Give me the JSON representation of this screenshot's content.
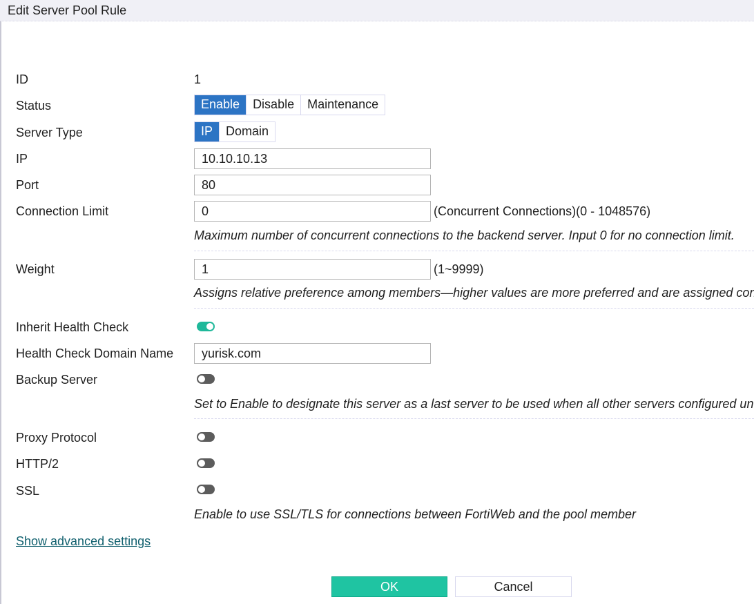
{
  "dialog": {
    "title": "Edit Server Pool Rule"
  },
  "fields": {
    "id": {
      "label": "ID",
      "value": "1"
    },
    "status": {
      "label": "Status",
      "options": [
        "Enable",
        "Disable",
        "Maintenance"
      ],
      "selected": "Enable"
    },
    "server_type": {
      "label": "Server Type",
      "options": [
        "IP",
        "Domain"
      ],
      "selected": "IP"
    },
    "ip": {
      "label": "IP",
      "value": "10.10.10.13"
    },
    "port": {
      "label": "Port",
      "value": "80"
    },
    "connection_limit": {
      "label": "Connection Limit",
      "value": "0",
      "suffix": "(Concurrent Connections)(0 - 1048576)",
      "help": "Maximum number of concurrent connections to the backend server. Input 0 for no connection limit."
    },
    "weight": {
      "label": "Weight",
      "value": "1",
      "suffix": "(1~9999)",
      "help": "Assigns relative preference among members—higher values are more preferred and are assigned connections more frequently."
    },
    "inherit_health_check": {
      "label": "Inherit Health Check",
      "enabled": true
    },
    "health_check_domain": {
      "label": "Health Check Domain Name",
      "value": "yurisk.com"
    },
    "backup_server": {
      "label": "Backup Server",
      "enabled": false,
      "help": "Set to Enable to designate this server as a last server to be used when all other servers configured under this pool are unavailable."
    },
    "proxy_protocol": {
      "label": "Proxy Protocol",
      "enabled": false
    },
    "http2": {
      "label": "HTTP/2",
      "enabled": false
    },
    "ssl": {
      "label": "SSL",
      "enabled": false,
      "help": "Enable to use SSL/TLS for connections between FortiWeb and the pool member"
    }
  },
  "links": {
    "advanced": "Show advanced settings"
  },
  "buttons": {
    "ok": "OK",
    "cancel": "Cancel"
  },
  "colors": {
    "accent_blue": "#2c74c4",
    "toggle_on": "#1fb89a",
    "ok_button": "#1fc4a2",
    "link": "#11606e"
  }
}
